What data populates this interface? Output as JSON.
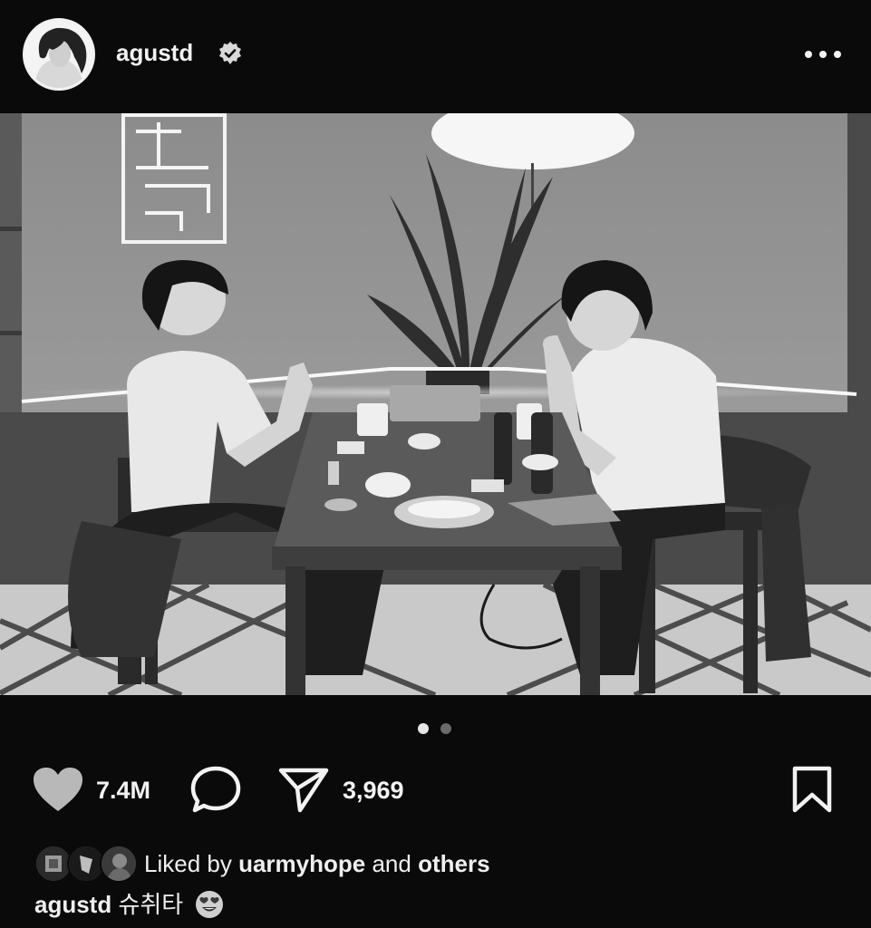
{
  "post": {
    "username": "agustd",
    "verified": true,
    "more_icon": "more-horizontal-icon"
  },
  "carousel": {
    "total": 2,
    "current": 1
  },
  "actions": {
    "like_icon": "heart-icon",
    "like_count": "7.4M",
    "comment_icon": "comment-icon",
    "share_icon": "send-icon",
    "share_count": "3,969",
    "save_icon": "bookmark-icon"
  },
  "likes": {
    "prefix": "Liked by",
    "user": "uarmyhope",
    "connector": "and",
    "others": "others"
  },
  "caption": {
    "username": "agustd",
    "text": "슈취타",
    "emoji": "heart-eyes-emoji"
  },
  "colors": {
    "background": "#0a0a0a",
    "text": "#f0f0f0",
    "like_filled": "#b8b8b8"
  }
}
